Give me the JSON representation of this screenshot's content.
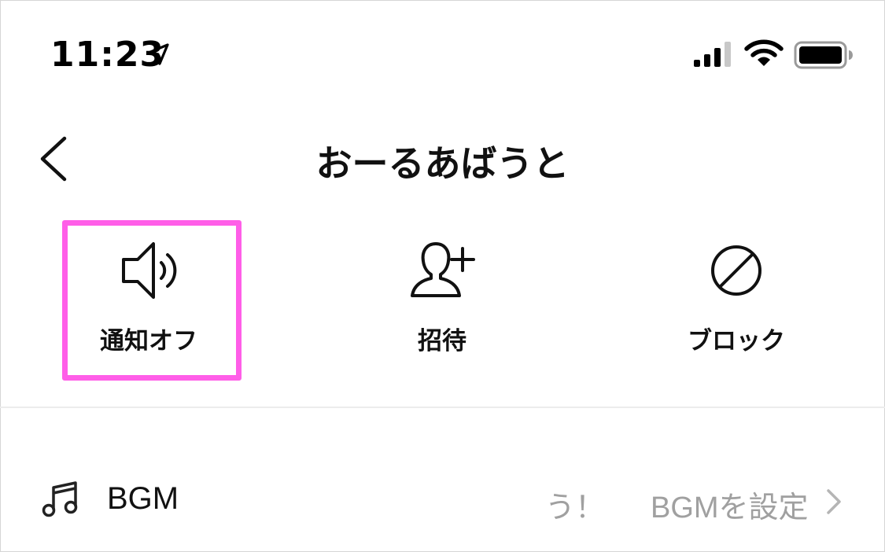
{
  "status_bar": {
    "time": "11:23",
    "icons": [
      "location-arrow-icon",
      "signal-icon",
      "wifi-icon",
      "battery-icon"
    ]
  },
  "header": {
    "title": "おーるあばうと",
    "back_icon": "chevron-left-icon"
  },
  "actions": [
    {
      "label": "通知オフ",
      "icon": "speaker-icon",
      "highlighted": true
    },
    {
      "label": "招待",
      "icon": "add-person-icon",
      "highlighted": false
    },
    {
      "label": "ブロック",
      "icon": "block-icon",
      "highlighted": false
    }
  ],
  "bgm": {
    "icon": "music-note-icon",
    "title": "BGM",
    "marquee_fragment": "う！",
    "value": "BGMを設定",
    "chevron": "chevron-right-icon"
  },
  "colors": {
    "highlight": "#ff5ee8",
    "secondary_text": "#a0a0a0",
    "divider": "#ececec"
  }
}
